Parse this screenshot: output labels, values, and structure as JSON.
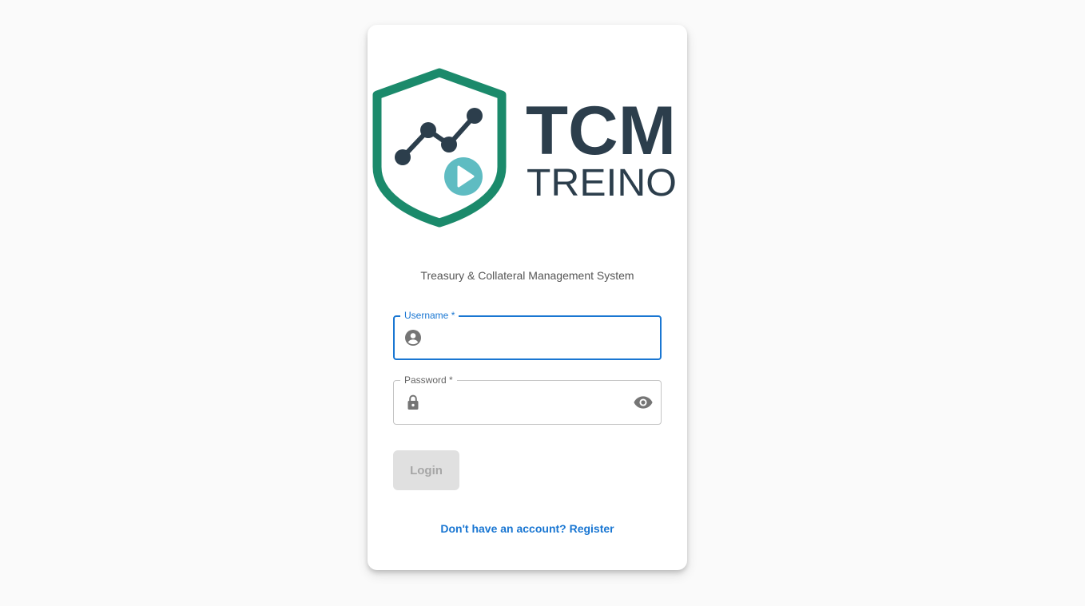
{
  "brand": {
    "name_line1": "TCM",
    "name_line2": "TREINO",
    "colors": {
      "shield": "#1b8a6b",
      "chart": "#2c3e4c",
      "play": "#5fbcc2",
      "text": "#2c3e4c"
    }
  },
  "subtitle": "Treasury & Collateral Management System",
  "form": {
    "username": {
      "label": "Username *",
      "value": "",
      "icon": "account-circle-icon"
    },
    "password": {
      "label": "Password *",
      "value": "",
      "icon": "lock-icon",
      "toggle_icon": "eye-icon"
    },
    "login_label": "Login",
    "register_text": "Don't have an account? Register"
  },
  "colors": {
    "accent": "#1976d2",
    "background": "#fafafa",
    "disabled_button_bg": "#e0e0e0",
    "disabled_button_text": "#a6a6a6"
  }
}
